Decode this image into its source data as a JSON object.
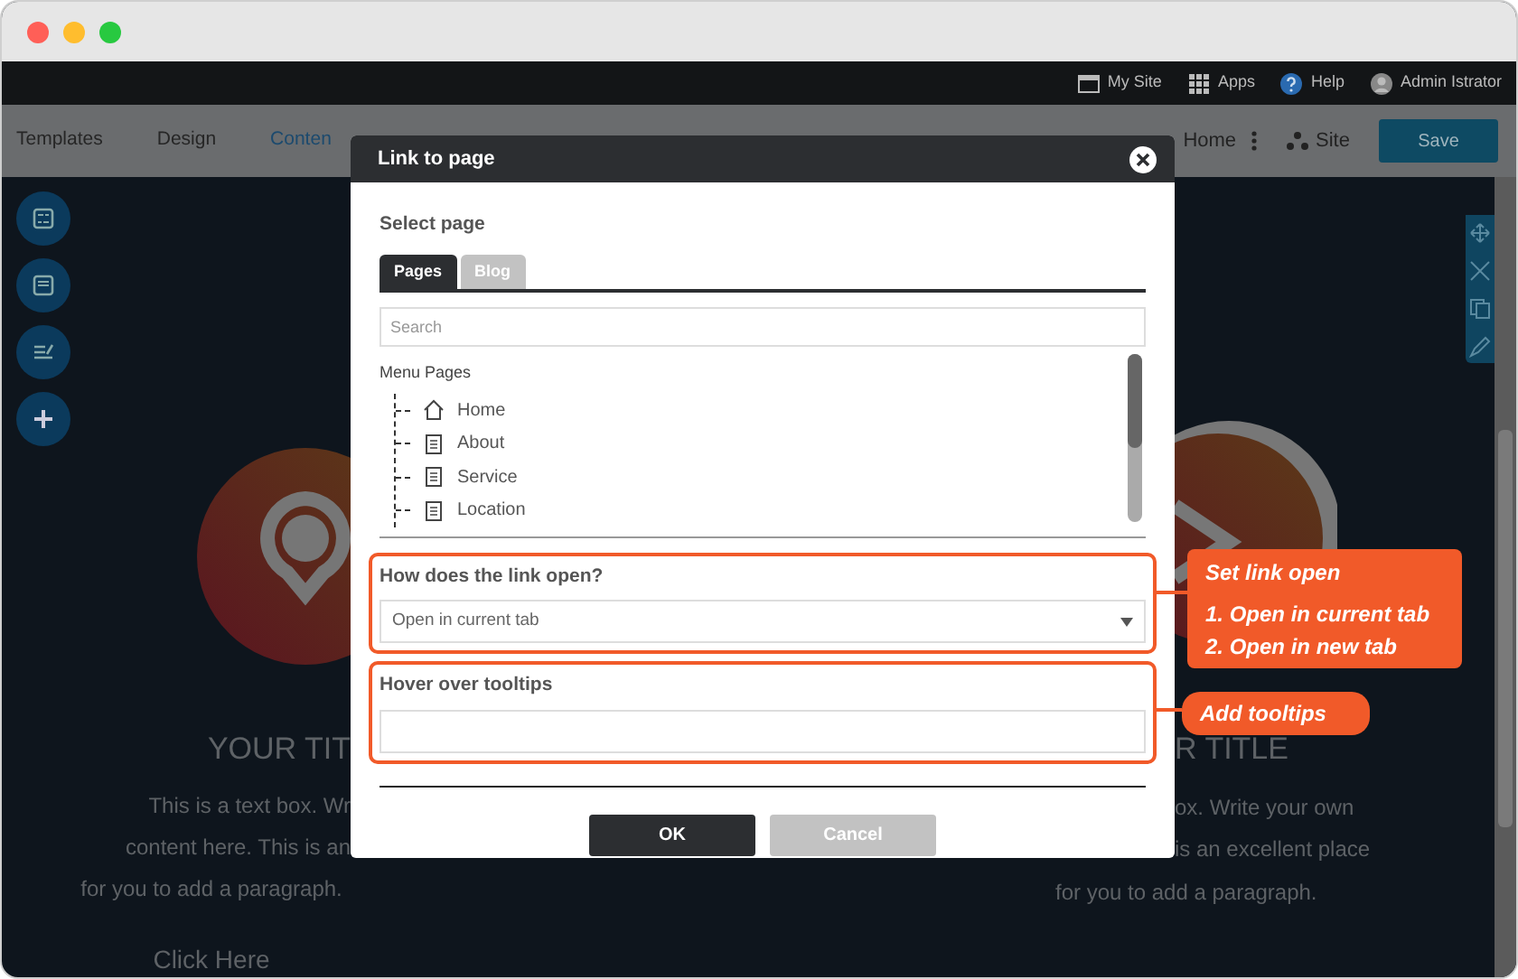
{
  "window_controls": [
    {
      "color": "#ff5f57"
    },
    {
      "color": "#ffbd2e"
    },
    {
      "color": "#28c940"
    }
  ],
  "top_bar": {
    "links": [
      {
        "kind": "site",
        "label": "My Site"
      },
      {
        "kind": "apps",
        "label": "Apps"
      },
      {
        "kind": "help",
        "label": "Help"
      },
      {
        "kind": "user",
        "label": "Admin Istrator"
      }
    ]
  },
  "toolbar": {
    "tabs": [
      {
        "label": "Templates",
        "selected": false
      },
      {
        "label": "Design",
        "selected": false
      },
      {
        "label": "Conten",
        "selected": true
      }
    ],
    "page": "Home",
    "site": "Site",
    "save": "Save"
  },
  "canvas": {
    "columns": [
      {
        "kind": "pin",
        "title": "YOUR TIT",
        "lines": [
          "This is a text box. Wr",
          "content here. This is an",
          "for you to add a paragraph."
        ],
        "link": "Click Here"
      },
      {
        "kind": "arrow",
        "title": "R TITLE",
        "lines": [
          "ox. Write your own",
          "is an excellent place",
          "for you to add a paragraph."
        ]
      }
    ]
  },
  "dialog": {
    "title": "Link to page",
    "section_label": "Select page",
    "tabs": [
      {
        "label": "Pages",
        "selected": true
      },
      {
        "label": "Blog",
        "selected": false
      }
    ],
    "search": {
      "placeholder": "Search"
    },
    "tree": {
      "label": "Menu Pages",
      "children": [
        {
          "label": "Home",
          "kind": "home"
        },
        {
          "label": "About",
          "kind": "page"
        },
        {
          "label": "Service",
          "kind": "page"
        },
        {
          "label": "Location",
          "kind": "page"
        }
      ]
    },
    "link_open": {
      "label": "How does the link open?",
      "value": "Open in current tab"
    },
    "tooltip": {
      "label": "Hover over tooltips"
    },
    "buttons": [
      {
        "label": "OK",
        "disabled": false
      },
      {
        "label": "Cancel",
        "disabled": true
      }
    ]
  },
  "callouts": [
    {
      "title": "Set link open",
      "lines": [
        "1. Open in current tab",
        "2. Open in new tab"
      ]
    },
    {
      "title": "Add tooltips"
    }
  ]
}
